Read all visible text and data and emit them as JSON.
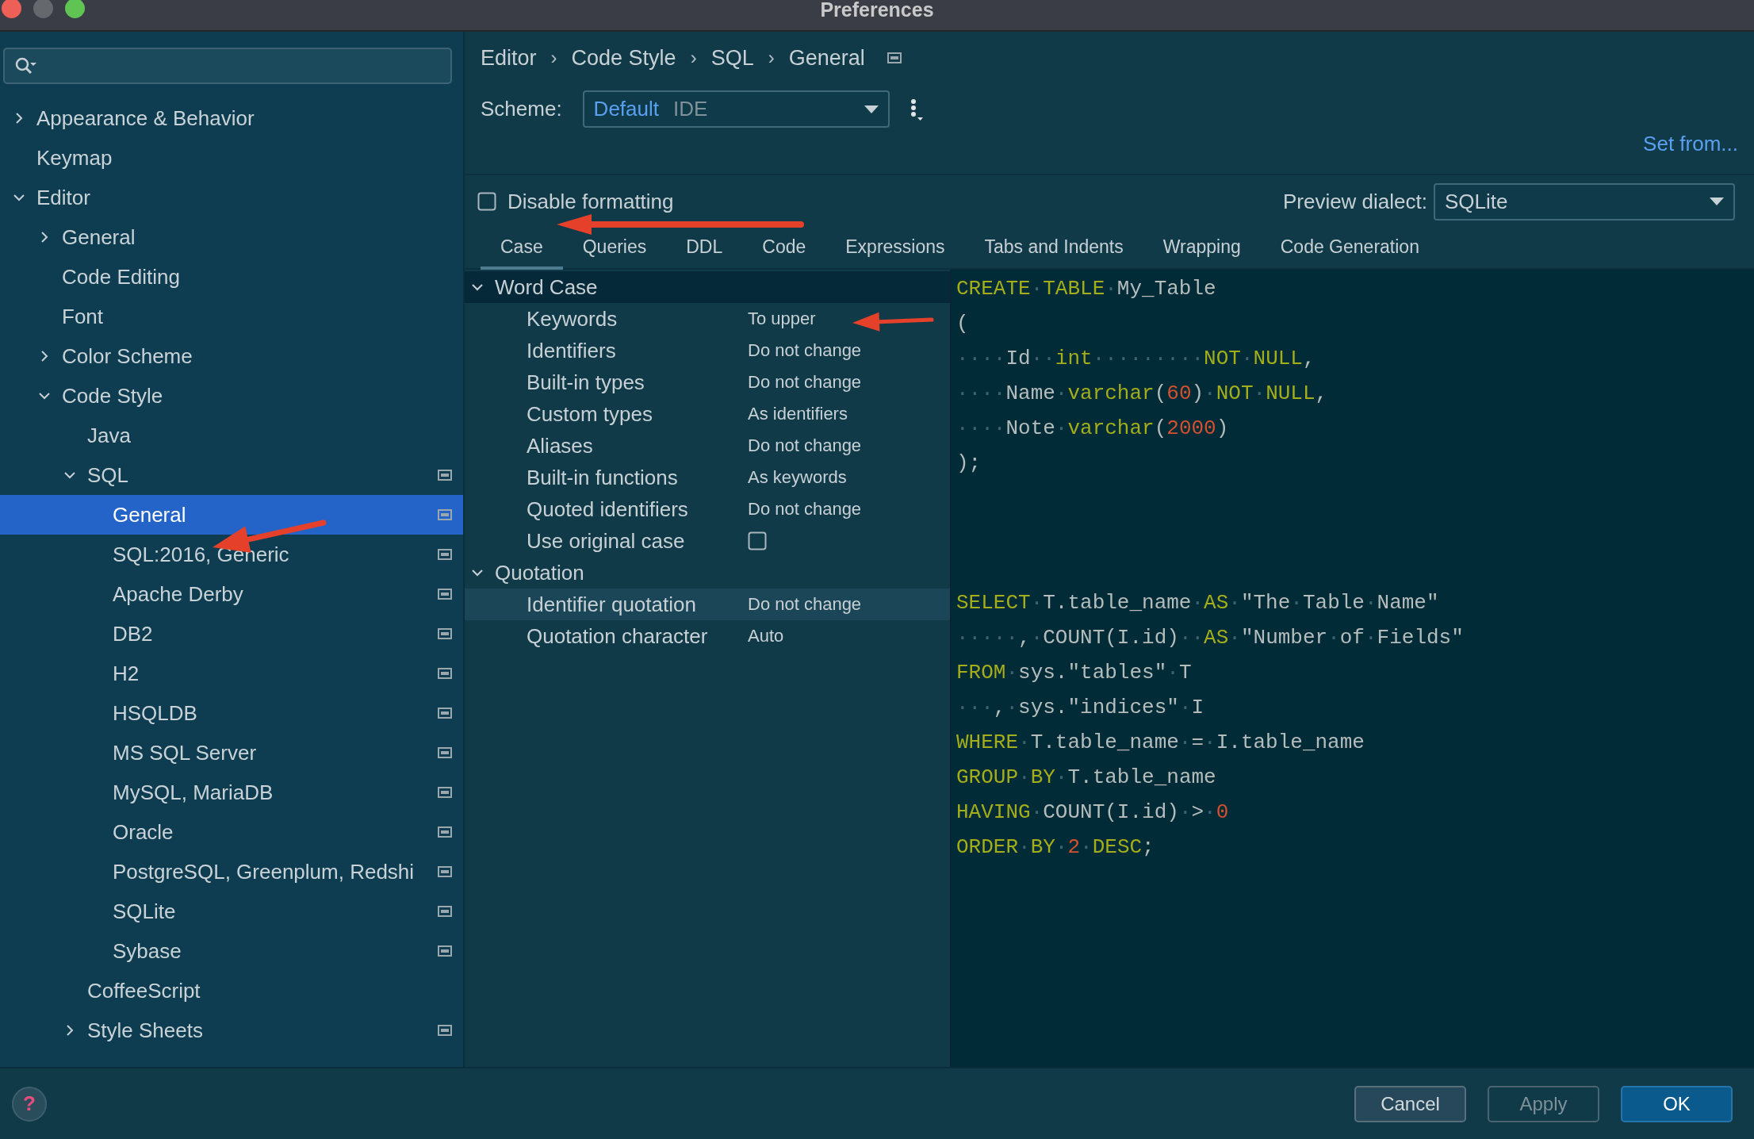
{
  "window": {
    "title": "Preferences"
  },
  "sidebar": {
    "tree": [
      {
        "label": "Appearance & Behavior",
        "expanded": false,
        "selected": false
      },
      {
        "label": "Keymap",
        "selected": false
      },
      {
        "label": "Editor",
        "expanded": true,
        "selected": false,
        "children": [
          {
            "label": "General",
            "expanded": false,
            "selected": false
          },
          {
            "label": "Code Editing",
            "selected": false
          },
          {
            "label": "Font",
            "selected": false
          },
          {
            "label": "Color Scheme",
            "expanded": false,
            "selected": false
          },
          {
            "label": "Code Style",
            "expanded": true,
            "selected": false,
            "children": [
              {
                "label": "Java",
                "selected": false
              },
              {
                "label": "SQL",
                "expanded": true,
                "selected": false,
                "icon": true,
                "children": [
                  {
                    "label": "General",
                    "selected": true,
                    "icon": true
                  },
                  {
                    "label": "SQL:2016, Generic",
                    "selected": false,
                    "icon": true
                  },
                  {
                    "label": "Apache Derby",
                    "selected": false,
                    "icon": true
                  },
                  {
                    "label": "DB2",
                    "selected": false,
                    "icon": true
                  },
                  {
                    "label": "H2",
                    "selected": false,
                    "icon": true
                  },
                  {
                    "label": "HSQLDB",
                    "selected": false,
                    "icon": true
                  },
                  {
                    "label": "MS SQL Server",
                    "selected": false,
                    "icon": true
                  },
                  {
                    "label": "MySQL, MariaDB",
                    "selected": false,
                    "icon": true
                  },
                  {
                    "label": "Oracle",
                    "selected": false,
                    "icon": true
                  },
                  {
                    "label": "PostgreSQL, Greenplum, Redshi",
                    "selected": false,
                    "icon": true
                  },
                  {
                    "label": "SQLite",
                    "selected": false,
                    "icon": true
                  },
                  {
                    "label": "Sybase",
                    "selected": false,
                    "icon": true
                  }
                ]
              },
              {
                "label": "CoffeeScript",
                "selected": false
              },
              {
                "label": "Style Sheets",
                "expanded": false,
                "selected": false,
                "icon": true
              }
            ]
          }
        ]
      }
    ]
  },
  "breadcrumb": {
    "items": [
      "Editor",
      "Code Style",
      "SQL",
      "General"
    ],
    "separator": "›"
  },
  "scheme": {
    "label": "Scheme:",
    "value": "Default",
    "tag": "IDE"
  },
  "set_from_link": "Set from...",
  "disable_formatting": {
    "label": "Disable formatting",
    "checked": false
  },
  "preview_dialect": {
    "label": "Preview dialect:",
    "value": "SQLite"
  },
  "tabs": [
    {
      "label": "Case",
      "selected": true
    },
    {
      "label": "Queries",
      "selected": false
    },
    {
      "label": "DDL",
      "selected": false
    },
    {
      "label": "Code",
      "selected": false
    },
    {
      "label": "Expressions",
      "selected": false
    },
    {
      "label": "Tabs and Indents",
      "selected": false
    },
    {
      "label": "Wrapping",
      "selected": false
    },
    {
      "label": "Code Generation",
      "selected": false
    }
  ],
  "options": [
    {
      "label": "Word Case",
      "expanded": true,
      "selected": true,
      "rows": [
        {
          "kind": "value",
          "label": "Keywords",
          "value": "To upper",
          "selected": false
        },
        {
          "kind": "value",
          "label": "Identifiers",
          "value": "Do not change",
          "selected": false
        },
        {
          "kind": "value",
          "label": "Built-in types",
          "value": "Do not change",
          "selected": false
        },
        {
          "kind": "value",
          "label": "Custom types",
          "value": "As identifiers",
          "selected": false
        },
        {
          "kind": "value",
          "label": "Aliases",
          "value": "Do not change",
          "selected": false
        },
        {
          "kind": "value",
          "label": "Built-in functions",
          "value": "As keywords",
          "selected": false
        },
        {
          "kind": "value",
          "label": "Quoted identifiers",
          "value": "Do not change",
          "selected": false
        },
        {
          "kind": "checkbox",
          "label": "Use original case",
          "checked": false,
          "selected": false
        }
      ]
    },
    {
      "label": "Quotation",
      "expanded": true,
      "selected": false,
      "rows": [
        {
          "kind": "value",
          "label": "Identifier quotation",
          "value": "Do not change",
          "selected": true
        },
        {
          "kind": "value",
          "label": "Quotation character",
          "value": "Auto",
          "selected": false
        }
      ]
    }
  ],
  "preview": {
    "blocks": [
      {
        "lines": [
          [
            {
              "kind": "keyword",
              "text": "CREATE"
            },
            {
              "kind": "space",
              "text": "·"
            },
            {
              "kind": "keyword",
              "text": "TABLE"
            },
            {
              "kind": "space",
              "text": "·"
            },
            {
              "kind": "text",
              "text": "My_Table"
            }
          ],
          [
            {
              "kind": "text",
              "text": "("
            }
          ],
          [
            {
              "kind": "space",
              "text": "····"
            },
            {
              "kind": "text",
              "text": "Id"
            },
            {
              "kind": "space",
              "text": "··"
            },
            {
              "kind": "keyword",
              "text": "int"
            },
            {
              "kind": "space",
              "text": "·········"
            },
            {
              "kind": "keyword",
              "text": "NOT"
            },
            {
              "kind": "space",
              "text": "·"
            },
            {
              "kind": "keyword",
              "text": "NULL"
            },
            {
              "kind": "text",
              "text": ","
            }
          ],
          [
            {
              "kind": "space",
              "text": "····"
            },
            {
              "kind": "text",
              "text": "Name"
            },
            {
              "kind": "space",
              "text": "·"
            },
            {
              "kind": "keyword",
              "text": "varchar"
            },
            {
              "kind": "text",
              "text": "("
            },
            {
              "kind": "number",
              "text": "60"
            },
            {
              "kind": "text",
              "text": ")"
            },
            {
              "kind": "space",
              "text": "·"
            },
            {
              "kind": "keyword",
              "text": "NOT"
            },
            {
              "kind": "space",
              "text": "·"
            },
            {
              "kind": "keyword",
              "text": "NULL"
            },
            {
              "kind": "text",
              "text": ","
            }
          ],
          [
            {
              "kind": "space",
              "text": "····"
            },
            {
              "kind": "text",
              "text": "Note"
            },
            {
              "kind": "space",
              "text": "·"
            },
            {
              "kind": "keyword",
              "text": "varchar"
            },
            {
              "kind": "text",
              "text": "("
            },
            {
              "kind": "number",
              "text": "2000"
            },
            {
              "kind": "text",
              "text": ")"
            }
          ],
          [
            {
              "kind": "text",
              "text": ");"
            }
          ]
        ]
      },
      {
        "lines": [
          [
            {
              "kind": "keyword",
              "text": "SELECT"
            },
            {
              "kind": "space",
              "text": "·"
            },
            {
              "kind": "text",
              "text": "T.table_name"
            },
            {
              "kind": "space",
              "text": "·"
            },
            {
              "kind": "keyword",
              "text": "AS"
            },
            {
              "kind": "space",
              "text": "·"
            },
            {
              "kind": "text",
              "text": "\"The"
            },
            {
              "kind": "space",
              "text": "·"
            },
            {
              "kind": "text",
              "text": "Table"
            },
            {
              "kind": "space",
              "text": "·"
            },
            {
              "kind": "text",
              "text": "Name\""
            }
          ],
          [
            {
              "kind": "space",
              "text": "·····"
            },
            {
              "kind": "text",
              "text": ","
            },
            {
              "kind": "space",
              "text": "·"
            },
            {
              "kind": "text",
              "text": "COUNT(I.id)"
            },
            {
              "kind": "space",
              "text": "··"
            },
            {
              "kind": "keyword",
              "text": "AS"
            },
            {
              "kind": "space",
              "text": "·"
            },
            {
              "kind": "text",
              "text": "\"Number"
            },
            {
              "kind": "space",
              "text": "·"
            },
            {
              "kind": "text",
              "text": "of"
            },
            {
              "kind": "space",
              "text": "·"
            },
            {
              "kind": "text",
              "text": "Fields\""
            }
          ],
          [
            {
              "kind": "keyword",
              "text": "FROM"
            },
            {
              "kind": "space",
              "text": "·"
            },
            {
              "kind": "text",
              "text": "sys.\"tables\""
            },
            {
              "kind": "space",
              "text": "·"
            },
            {
              "kind": "text",
              "text": "T"
            }
          ],
          [
            {
              "kind": "space",
              "text": "···"
            },
            {
              "kind": "text",
              "text": ","
            },
            {
              "kind": "space",
              "text": "·"
            },
            {
              "kind": "text",
              "text": "sys.\"indices\""
            },
            {
              "kind": "space",
              "text": "·"
            },
            {
              "kind": "text",
              "text": "I"
            }
          ],
          [
            {
              "kind": "keyword",
              "text": "WHERE"
            },
            {
              "kind": "space",
              "text": "·"
            },
            {
              "kind": "text",
              "text": "T.table_name"
            },
            {
              "kind": "space",
              "text": "·"
            },
            {
              "kind": "text",
              "text": "="
            },
            {
              "kind": "space",
              "text": "·"
            },
            {
              "kind": "text",
              "text": "I.table_name"
            }
          ],
          [
            {
              "kind": "keyword",
              "text": "GROUP"
            },
            {
              "kind": "space",
              "text": "·"
            },
            {
              "kind": "keyword",
              "text": "BY"
            },
            {
              "kind": "space",
              "text": "·"
            },
            {
              "kind": "text",
              "text": "T.table_name"
            }
          ],
          [
            {
              "kind": "keyword",
              "text": "HAVING"
            },
            {
              "kind": "space",
              "text": "·"
            },
            {
              "kind": "text",
              "text": "COUNT(I.id)"
            },
            {
              "kind": "space",
              "text": "·"
            },
            {
              "kind": "text",
              "text": ">"
            },
            {
              "kind": "space",
              "text": "·"
            },
            {
              "kind": "number",
              "text": "0"
            }
          ],
          [
            {
              "kind": "keyword",
              "text": "ORDER"
            },
            {
              "kind": "space",
              "text": "·"
            },
            {
              "kind": "keyword",
              "text": "BY"
            },
            {
              "kind": "space",
              "text": "·"
            },
            {
              "kind": "number",
              "text": "2"
            },
            {
              "kind": "space",
              "text": "·"
            },
            {
              "kind": "keyword",
              "text": "DESC"
            },
            {
              "kind": "text",
              "text": ";"
            }
          ]
        ]
      }
    ]
  },
  "help_button": "?",
  "buttons": [
    {
      "label": "Cancel",
      "kind": "secondary",
      "disabled": false
    },
    {
      "label": "Apply",
      "kind": "secondary",
      "disabled": true
    },
    {
      "label": "OK",
      "kind": "default",
      "disabled": false
    }
  ]
}
